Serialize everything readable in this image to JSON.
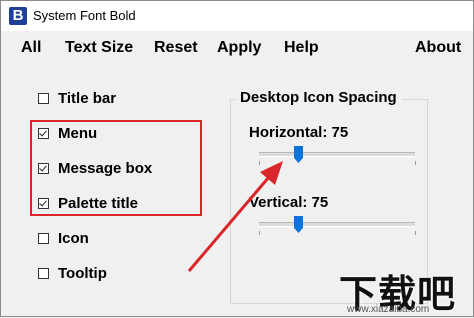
{
  "window": {
    "icon_letter": "B",
    "title": "System Font Bold"
  },
  "menu": {
    "items": [
      "All",
      "Text Size",
      "Reset",
      "Apply",
      "Help",
      "About"
    ]
  },
  "checkboxes": [
    {
      "label": "Title bar",
      "checked": false
    },
    {
      "label": "Menu",
      "checked": true
    },
    {
      "label": "Message box",
      "checked": true
    },
    {
      "label": "Palette title",
      "checked": true
    },
    {
      "label": "Icon",
      "checked": false
    },
    {
      "label": "Tooltip",
      "checked": false
    }
  ],
  "spacing_group": {
    "title": "Desktop Icon Spacing",
    "horizontal_label": "Horizontal: 75",
    "horizontal_value": 75,
    "vertical_label": "Vertical: 75",
    "vertical_value": 75
  },
  "annotation": {
    "highlight_color": "#d9262a",
    "arrow_color": "#d9262a"
  },
  "watermark": {
    "text": "下载吧",
    "url": "www.xiazaiba.com"
  }
}
